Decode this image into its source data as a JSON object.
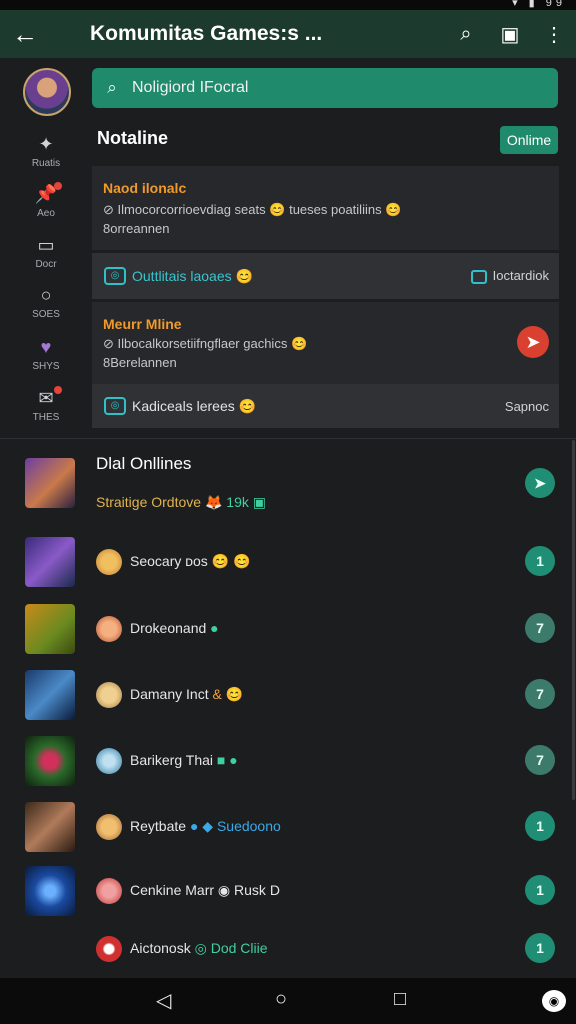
{
  "app": {
    "title": "Komumitas Games:s ...",
    "back_icon": "arrow-left-icon",
    "actions": [
      "search-icon",
      "calendar-icon",
      "more-vertical-icon"
    ]
  },
  "rail": {
    "items": [
      {
        "label": "Ruatis",
        "icon": "compass-icon",
        "badge": false
      },
      {
        "label": "Aeo",
        "icon": "pin-icon",
        "badge": true
      },
      {
        "label": "Docr",
        "icon": "chat-box-icon",
        "badge": false
      },
      {
        "label": "SOES",
        "icon": "search-circle-icon",
        "badge": false
      },
      {
        "label": "SHYS",
        "icon": "heart-icon",
        "badge": false
      },
      {
        "label": "THES",
        "icon": "message-icon",
        "badge": true
      }
    ]
  },
  "search": {
    "placeholder": "Noligiord IFocral"
  },
  "section": {
    "title": "Notaline",
    "online_label": "Onlime"
  },
  "cards": [
    {
      "name": "Naod ilonalc",
      "line1": "Ilmocorcorrioevdiag seats",
      "emoji1": "😊",
      "line1b": "tueses poatiliins",
      "emoji2": "😊",
      "line2": "8orreannen"
    },
    {
      "name": "Meurr Mline",
      "line1": "Ilbocalkorsetiifngflaer gachics",
      "emoji1": "😊",
      "line2": "8Berelannen"
    }
  ],
  "strips": [
    {
      "text": "Outtlitais laoaes",
      "emoji": "😊",
      "right": "Ioctardiok"
    },
    {
      "text": "Kadiceals lerees",
      "emoji": "😊",
      "right": "Sapnoc"
    }
  ],
  "list": {
    "title": "Dlal Onllines",
    "subtitle": "Straitige Ordtove",
    "subtitle_emoji": "🦊",
    "subtitle_num": "19k",
    "rows": [
      {
        "name": "Seocary ᴅos",
        "icons": "😊 😊",
        "action": "1"
      },
      {
        "name": "Drokeonand",
        "icons": "●",
        "action": "7"
      },
      {
        "name": "Damany Inct",
        "icons": "& 😊",
        "action": "7"
      },
      {
        "name": "Barikerg Thai",
        "icons": "■ ●",
        "action": "7"
      },
      {
        "name": "Reytbate",
        "icons": "● ◆",
        "extra": "Suedoono",
        "action": "1"
      },
      {
        "name": "Cenkine Marr",
        "icons": "◉",
        "extra2": "Rusk D",
        "action": "1"
      },
      {
        "name": "Aictonosk",
        "icons": "◎",
        "extra": "Dod Cliie",
        "action": "1"
      }
    ]
  },
  "navbar": {
    "icons": [
      "back-triangle-icon",
      "home-circle-icon",
      "recents-square-icon",
      "camera-icon"
    ]
  },
  "colors": {
    "accent": "#1f8a6c",
    "appbar": "#1d3a2e",
    "background": "#1c1d1f",
    "warning": "#f09a2c",
    "danger": "#d9402f"
  }
}
